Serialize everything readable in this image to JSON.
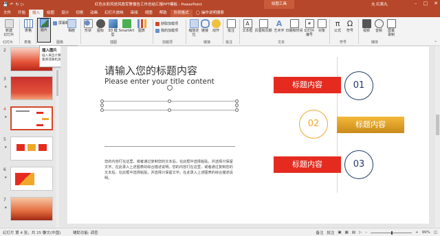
{
  "window": {
    "doc_title": "红色水彩风党风政军警报告工作总结汇报PPT模板 - PowerPoint",
    "context_title": "绘图工具",
    "user": "允 红燕丸",
    "qat_icons": [
      "save-icon",
      "undo-icon",
      "redo-icon",
      "start-icon"
    ],
    "buttons": [
      "minimize",
      "restore",
      "close"
    ]
  },
  "tabs": [
    {
      "label": "文件"
    },
    {
      "label": "开始"
    },
    {
      "label": "插入",
      "active": true
    },
    {
      "label": "绘图"
    },
    {
      "label": "设计"
    },
    {
      "label": "切换"
    },
    {
      "label": "动画"
    },
    {
      "label": "幻灯片放映"
    },
    {
      "label": "审阅"
    },
    {
      "label": "视图"
    },
    {
      "label": "帮助"
    },
    {
      "label": "形状格式",
      "ctx": true
    },
    {
      "label": "操作说明搜索",
      "search": true
    }
  ],
  "ribbon": {
    "new_slide": "新建\n幻灯片",
    "table": "表格",
    "picture": "图片",
    "screenshot": "屏幕截图",
    "album": "相册",
    "shapes": "形状",
    "icons": "图标",
    "model3d": "3D 模\n型",
    "smartart": "SmartArt",
    "chart": "图表",
    "get_addins": "获取加载项",
    "my_addins": "我的加载项",
    "zoom": "缩放定\n位",
    "link": "链接",
    "action": "动作",
    "comment": "批注",
    "textbox": "文本框",
    "header_footer": "页眉和页脚",
    "wordart": "艺术字",
    "date_time": "日期和时间",
    "slide_number": "幻灯片\n编号",
    "object": "对象",
    "equation": "公式",
    "symbol": "符号",
    "video": "视频",
    "audio": "音频",
    "screen_record": "屏幕\n录制",
    "groups": {
      "slides": "幻灯片",
      "tables": "表格",
      "images": "图像",
      "illustrations": "插图",
      "addins": "加载项",
      "links": "链接",
      "comments": "批注",
      "text": "文本",
      "symbols": "符号",
      "media": "媒体"
    }
  },
  "tooltip": {
    "title": "插入图片",
    "body": "插入来自计算机、图像集库或联机源的图片。"
  },
  "thumbnails": [
    {
      "num": "2",
      "star": "★"
    },
    {
      "num": "3",
      "star": "★"
    },
    {
      "num": "4",
      "star": "★",
      "active": true
    },
    {
      "num": "5",
      "star": "★"
    },
    {
      "num": "6",
      "star": "★"
    },
    {
      "num": "7",
      "star": "★"
    }
  ],
  "slide": {
    "title": "请输入您的标题内容",
    "subtitle": "Please enter your title content",
    "body": "您的内容打在这里，或者通过复制您的文本后，在此框中选择粘贴，并选择只保留文字。在此录入上述图表的综合描述说明。您的内容打在这里，或者通过复制您的文本后，在此框中选择粘贴，并选择只保留文字。在此录入上述图表的综合描述说明。",
    "items": [
      {
        "label": "标题内容",
        "num": "01",
        "color": "#e52b1f"
      },
      {
        "label": "标题内容",
        "num": "02",
        "color": "#f0a82b"
      },
      {
        "label": "标题内容",
        "num": "03",
        "color": "#e52b1f"
      }
    ]
  },
  "status": {
    "slide_info": "幻灯片 第 4 张，共 25 张",
    "language": "中文(中国)",
    "accessibility": "辅助功能: 调查",
    "notes": "备注",
    "comments": "批注",
    "zoom": "99%"
  }
}
